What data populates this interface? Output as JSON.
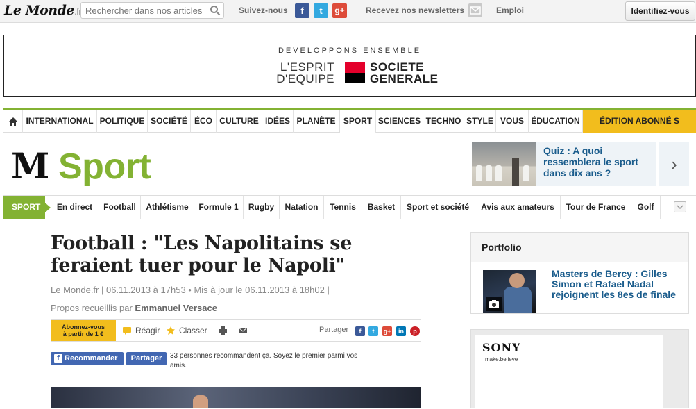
{
  "topbar": {
    "logo": "Le Monde",
    "logo_suffix": ".fr",
    "search_placeholder": "Rechercher dans nos articles",
    "follow_label": "Suivez-nous",
    "social": [
      {
        "name": "facebook",
        "glyph": "f",
        "color": "#3b5998"
      },
      {
        "name": "twitter",
        "glyph": "t",
        "color": "#33a9e0"
      },
      {
        "name": "google-plus",
        "glyph": "g+",
        "color": "#dd4b39"
      }
    ],
    "newsletter_label": "Recevez nos newsletters",
    "jobs_label": "Emploi",
    "login_label": "Identifiez-vous"
  },
  "banner": {
    "tagline": "DEVELOPPONS ENSEMBLE",
    "line1": "L'ESPRIT",
    "line2": "D'EQUIPE",
    "brand1": "SOCIETE",
    "brand2": "GENERALE",
    "colors": {
      "red": "#e4002b",
      "black": "#000000"
    }
  },
  "nav": {
    "home_icon": "home-icon",
    "items": [
      "INTERNATIONAL",
      "POLITIQUE",
      "SOCIÉTÉ",
      "ÉCO",
      "CULTURE",
      "IDÉES",
      "PLANÈTE",
      "SPORT",
      "SCIENCES",
      "TECHNO",
      "STYLE",
      "VOUS",
      "ÉDUCATION"
    ],
    "active": "SPORT",
    "subscriber_label": "ÉDITION ABONNÉ S",
    "accent": "#83b233",
    "subscriber_color": "#f2bd1d"
  },
  "section": {
    "logo_glyph": "M",
    "title": "Sport",
    "promo_text": "Quiz : A quoi ressemblera le sport dans dix ans ?"
  },
  "subnav": {
    "tag": "SPORT",
    "items": [
      "En direct",
      "Football",
      "Athlétisme",
      "Formule 1",
      "Rugby",
      "Natation",
      "Tennis",
      "Basket",
      "Sport et société",
      "Avis aux amateurs",
      "Tour de France",
      "Golf"
    ]
  },
  "article": {
    "headline": "Football : \"Les Napolitains se feraient tuer pour le Napoli\"",
    "meta": "Le Monde.fr | 06.11.2013 à 17h53 • Mis à jour le 06.11.2013 à 18h02 |",
    "author_prefix": "Propos recueillis par",
    "author": "Emmanuel Versace",
    "subscribe_line1": "Abonnez-vous",
    "subscribe_line2": "à partir de 1 €",
    "react_label": "Réagir",
    "save_label": "Classer",
    "share_label": "Partager",
    "share_networks": [
      {
        "name": "facebook",
        "glyph": "f",
        "color": "#3b5998"
      },
      {
        "name": "twitter",
        "glyph": "t",
        "color": "#33a9e0"
      },
      {
        "name": "google-plus",
        "glyph": "g+",
        "color": "#dd4b39"
      },
      {
        "name": "linkedin",
        "glyph": "in",
        "color": "#0077b5"
      },
      {
        "name": "pinterest",
        "glyph": "p",
        "color": "#cb2027"
      }
    ],
    "fb_recommend": "Recommander",
    "fb_share": "Partager",
    "fb_text": "33 personnes recommandent ça. Soyez le premier parmi vos amis."
  },
  "sidebar": {
    "portfolio_title": "Portfolio",
    "portfolio_text": "Masters de Bercy : Gilles Simon et Rafael Nadal rejoignent les 8es de finale",
    "ad_brand": "SONY",
    "ad_tagline": "make.believe"
  }
}
